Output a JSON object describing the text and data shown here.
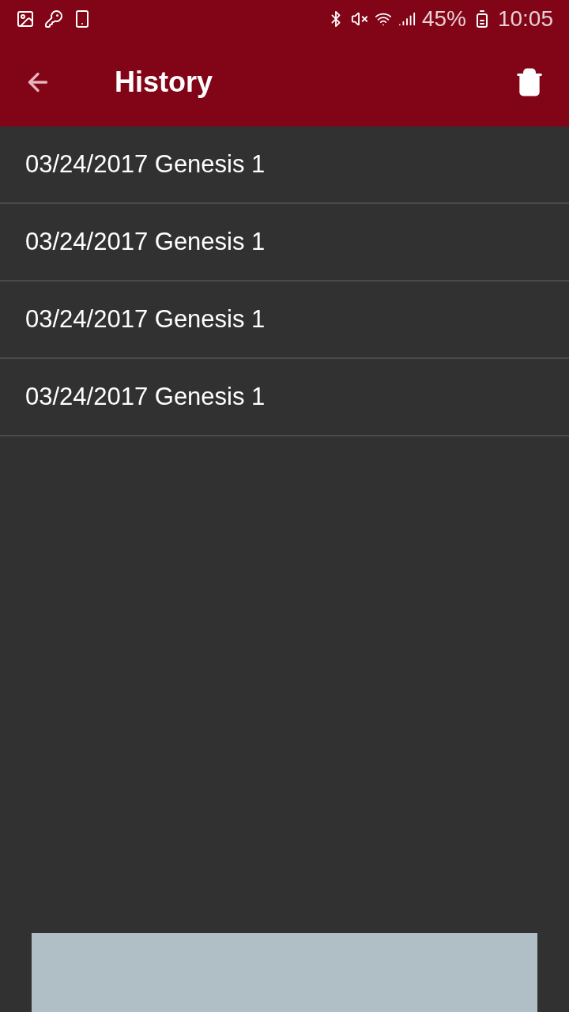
{
  "status_bar": {
    "battery": "45%",
    "time": "10:05"
  },
  "toolbar": {
    "title": "History"
  },
  "history": [
    {
      "label": "03/24/2017 Genesis 1"
    },
    {
      "label": "03/24/2017 Genesis 1"
    },
    {
      "label": "03/24/2017 Genesis 1"
    },
    {
      "label": "03/24/2017 Genesis 1"
    }
  ]
}
